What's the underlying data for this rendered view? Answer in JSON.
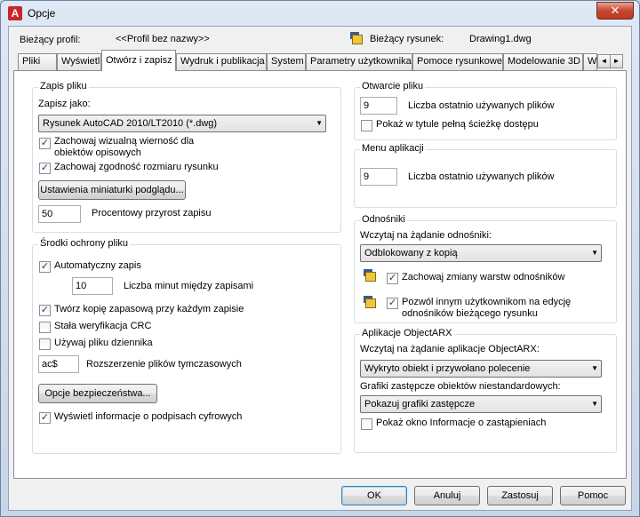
{
  "window": {
    "title": "Opcje",
    "close_glyph": "✕"
  },
  "header": {
    "profile_label": "Bieżący profil:",
    "profile_value": "<<Profil bez nazwy>>",
    "drawing_label": "Bieżący rysunek:",
    "drawing_value": "Drawing1.dwg",
    "drawing_icon": "drawing-icon"
  },
  "tabs": [
    {
      "label": "Pliki"
    },
    {
      "label": "Wyświetl"
    },
    {
      "label": "Otwórz i zapisz"
    },
    {
      "label": "Wydruk i publikacja"
    },
    {
      "label": "System"
    },
    {
      "label": "Parametry użytkownika"
    },
    {
      "label": "Pomoce rysunkowe"
    },
    {
      "label": "Modelowanie 3D"
    },
    {
      "label": "W"
    }
  ],
  "tab_scroll": {
    "left": "◄",
    "right": "►"
  },
  "save": {
    "title": "Zapis pliku",
    "save_as_label": "Zapisz jako:",
    "save_as_value": "Rysunek AutoCAD 2010/LT2010 (*.dwg)",
    "keep_visual_line1": "Zachowaj wizualną wierność dla",
    "keep_visual_line2": "obiektów opisowych",
    "keep_visual_checked": true,
    "keep_size": "Zachowaj zgodność rozmiaru rysunku",
    "keep_size_checked": true,
    "thumbnail_button": "Ustawienia miniaturki podglądu...",
    "increment_value": "50",
    "increment_label": "Procentowy przyrost zapisu"
  },
  "safety": {
    "title": "Środki ochrony pliku",
    "autosave_label": "Automatyczny zapis",
    "autosave_checked": true,
    "minutes_value": "10",
    "minutes_label": "Liczba minut między zapisami",
    "backup_label": "Twórz kopię zapasową przy każdym zapisie",
    "backup_checked": true,
    "crc_label": "Stała weryfikacja CRC",
    "crc_checked": false,
    "log_label": "Używaj pliku dziennika",
    "log_checked": false,
    "ext_value": "ac$",
    "ext_label": "Rozszerzenie plików tymczasowych",
    "security_button": "Opcje bezpieczeństwa...",
    "signatures_label": "Wyświetl informacje o podpisach cyfrowych",
    "signatures_checked": true
  },
  "open": {
    "title": "Otwarcie pliku",
    "recent_value": "9",
    "recent_label": "Liczba ostatnio używanych plików",
    "full_path_label": "Pokaż w tytule pełną ścieżkę dostępu",
    "full_path_checked": false
  },
  "app_menu": {
    "title": "Menu aplikacji",
    "recent_value": "9",
    "recent_label": "Liczba ostatnio używanych plików"
  },
  "xref": {
    "title": "Odnośniki",
    "demand_label": "Wczytaj na żądanie odnośniki:",
    "demand_value": "Odblokowany z kopią",
    "retain_label": "Zachowaj zmiany warstw odnośników",
    "retain_checked": true,
    "allow_line1": "Pozwól innym użytkownikom na edycję",
    "allow_line2": "odnośników bieżącego rysunku",
    "allow_checked": true
  },
  "arx": {
    "title": "Aplikacje ObjectARX",
    "demand_label": "Wczytaj na żądanie aplikacje ObjectARX:",
    "demand_value": "Wykryto obiekt i przywołano polecenie",
    "proxy_label": "Grafiki zastępcze obiektów niestandardowych:",
    "proxy_value": "Pokazuj grafiki zastępcze",
    "notice_label": "Pokaż okno Informacje o zastąpieniach",
    "notice_checked": false
  },
  "footer": {
    "ok": "OK",
    "cancel": "Anuluj",
    "apply": "Zastosuj",
    "help": "Pomoc"
  }
}
